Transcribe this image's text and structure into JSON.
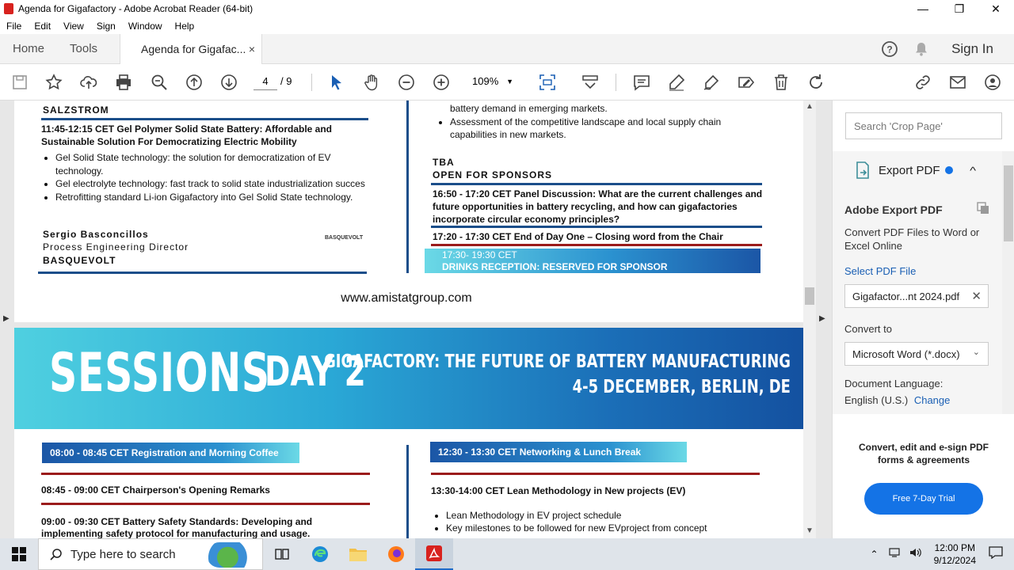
{
  "window": {
    "title": "Agenda for Gigafactory - Adobe Acrobat Reader (64-bit)",
    "minimize": "—",
    "maximize": "❐",
    "close": "✕"
  },
  "menu": [
    "File",
    "Edit",
    "View",
    "Sign",
    "Window",
    "Help"
  ],
  "tabs": {
    "home": "Home",
    "tools": "Tools",
    "doc": "Agenda for Gigafac...",
    "close": "×",
    "sign_in": "Sign In"
  },
  "toolbar": {
    "page_current": "4",
    "page_total": "/ 9",
    "zoom": "109%"
  },
  "page1": {
    "company_top": "SALZSTROM",
    "session_title": "11:45-12:15 CET Gel Polymer Solid State Battery: Affordable and Sustainable Solution For Democratizing Electric Mobility",
    "bullets": [
      "Gel Solid State technology: the solution for democratization of EV technology.",
      "Gel electrolyte technology: fast track to solid state industrialization succes",
      "Retrofitting standard Li-ion Gigafactory into Gel Solid State technology."
    ],
    "speaker_name": "Sergio Basconcillos",
    "speaker_role": "Process Engineering Director",
    "speaker_company": "BASQUEVOLT",
    "logo_text": "BASQUEVOLT",
    "right_bullets": [
      "battery demand in emerging markets.",
      "Assessment of the competitive landscape and local supply chain capabilities in new markets."
    ],
    "tba": "TBA",
    "open_sponsors": "OPEN FOR SPONSORS",
    "panel": "16:50 - 17:20 CET Panel Discussion: What are the current challenges and future opportunities in battery recycling, and how can gigafactories incorporate circular economy principles?",
    "end_day": "17:20 - 17:30 CET End of Day One – Closing word from the Chair",
    "drinks_time": "17:30- 19:30 CET",
    "drinks_label": "DRINKS RECEPTION: RESERVED FOR SPONSOR",
    "website": "www.amistatgroup.com"
  },
  "page2": {
    "sessions": "SESSIONS",
    "day": "DAY 2",
    "giga": "GIGAFACTORY: THE FUTURE OF BATTERY MANUFACTURING",
    "date": "4-5 DECEMBER, BERLIN, DE",
    "registration": "08:00 - 08:45 CET Registration and Morning Coffee",
    "opening": "08:45 - 09:00 CET Chairperson's Opening Remarks",
    "safety": "09:00 - 09:30 CET Battery Safety Standards: Developing and implementing safety protocol for manufacturing and usage.",
    "lunch": "12:30 - 13:30 CET Networking & Lunch Break",
    "lean": "13:30-14:00 CET Lean Methodology in New projects (EV)",
    "lean_bullets": [
      "Lean Methodology in EV project schedule",
      "Key milestones to be followed for new EVproject from concept"
    ]
  },
  "rightpanel": {
    "search_placeholder": "Search 'Crop Page'",
    "export": "Export PDF",
    "heading": "Adobe Export PDF",
    "desc": "Convert PDF Files to Word or Excel Online",
    "select_file": "Select PDF File",
    "file_name": "Gigafactor...nt 2024.pdf",
    "convert_to": "Convert to",
    "format": "Microsoft Word (*.docx)",
    "doc_lang": "Document Language:",
    "lang": "English (U.S.)",
    "change": "Change",
    "promo": "Convert, edit and e-sign PDF forms & agreements",
    "trial": "Free 7-Day Trial"
  },
  "taskbar": {
    "search": "Type here to search",
    "time": "12:00 PM",
    "date": "9/12/2024"
  },
  "colors": {
    "heading_blue": "#1b4e8a",
    "rule_red": "#9b1b1b",
    "acrobat_red": "#d8221e",
    "accent": "#1473e6"
  }
}
